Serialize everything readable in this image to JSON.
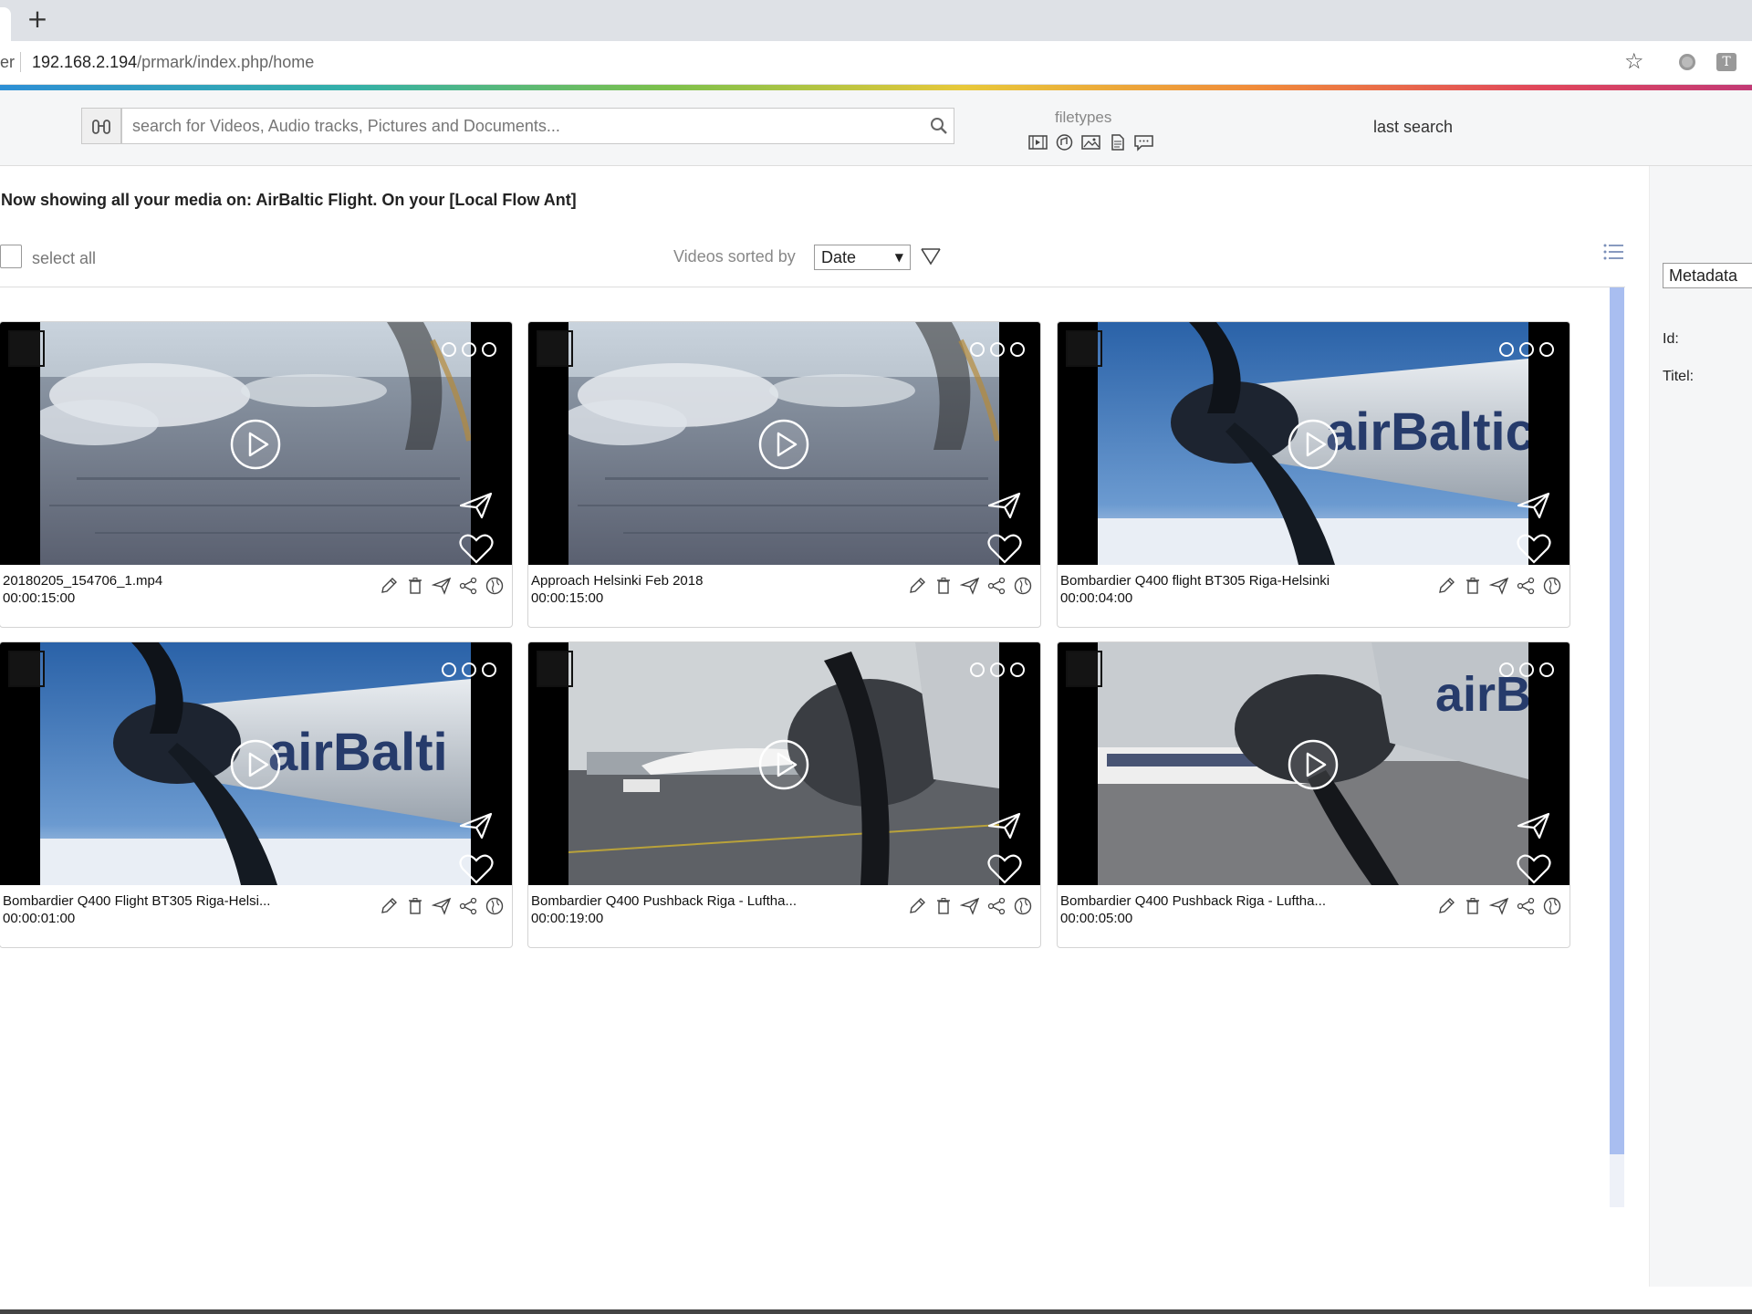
{
  "browser": {
    "address_left_fragment": "er",
    "url_host": "192.168.2.194",
    "url_path": "/prmark/index.php/home",
    "new_tab": "+"
  },
  "header": {
    "search_placeholder": "search for Videos, Audio tracks, Pictures and Documents...",
    "filetypes_label": "filetypes",
    "filetype_icons": [
      "video-icon",
      "audio-icon",
      "picture-icon",
      "document-icon",
      "comment-icon"
    ],
    "last_search": "last search"
  },
  "main": {
    "headline": "Now showing all your media on: AirBaltic Flight. On your [Local Flow Ant]",
    "select_all": "select all",
    "sorted_by_label": "Videos sorted by",
    "sort_value": "Date"
  },
  "right_panel": {
    "metadata_select": "Metadata",
    "id_label": "Id:",
    "titel_label": "Titel:"
  },
  "cards": [
    {
      "title": "20180205_154706_1.mp4",
      "duration": "00:00:15:00",
      "scene": "city"
    },
    {
      "title": "Approach Helsinki Feb 2018",
      "duration": "00:00:15:00",
      "scene": "city"
    },
    {
      "title": "Bombardier Q400 flight BT305 Riga-Helsinki",
      "duration": "00:00:04:00",
      "scene": "engine",
      "brand": "airBaltic"
    },
    {
      "title": "Bombardier Q400 Flight BT305 Riga-Helsi...",
      "duration": "00:00:01:00",
      "scene": "engine",
      "brand": "airBalti"
    },
    {
      "title": "Bombardier Q400 Pushback Riga - Luftha...",
      "duration": "00:00:19:00",
      "scene": "ground"
    },
    {
      "title": "Bombardier Q400 Pushback Riga - Luftha...",
      "duration": "00:00:05:00",
      "scene": "ground2",
      "brand": "airB"
    }
  ],
  "colors": {
    "scroll_thumb": "#a9bef0",
    "header_bg": "#f5f6f7"
  }
}
